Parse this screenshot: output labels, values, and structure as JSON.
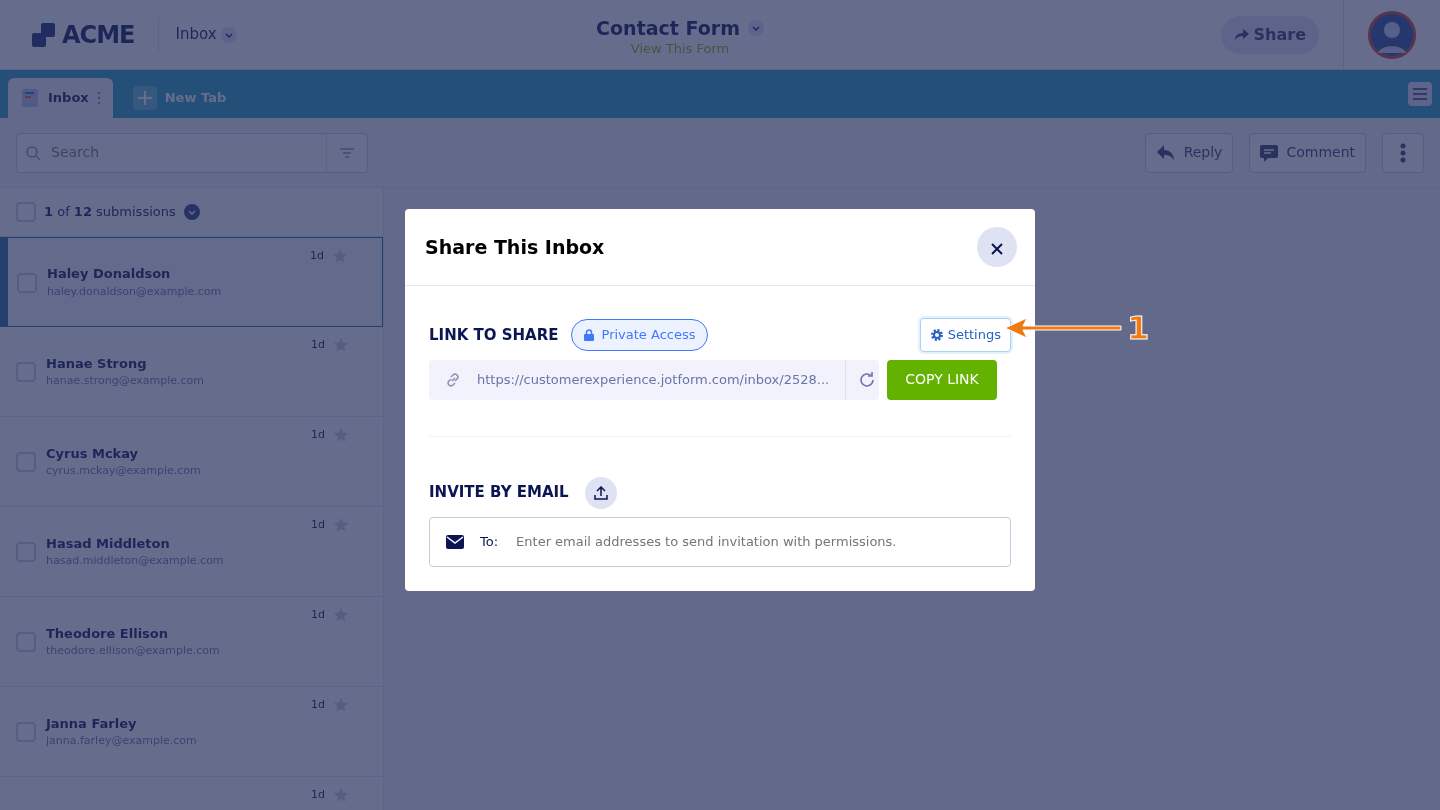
{
  "header": {
    "logo": "ACME",
    "section": "Inbox",
    "form_title": "Contact Form",
    "form_link": "View This Form",
    "share": "Share"
  },
  "tabs": [
    {
      "label": "Inbox",
      "selected": true
    },
    {
      "label": "New Tab",
      "selected": false
    }
  ],
  "search": {
    "placeholder": "Search"
  },
  "actions": [
    "Reply",
    "Comment"
  ],
  "select_all": {
    "checked": false
  },
  "list_summary": "**1** of **12** submissions",
  "submissions": [
    {
      "name": "Haley Donaldson",
      "email": "haley.donaldson@example.com",
      "time": "1d",
      "selected": true,
      "starred": false
    },
    {
      "name": "Hanae Strong",
      "email": "hanae.strong@example.com",
      "time": "1d",
      "selected": false,
      "starred": false
    },
    {
      "name": "Cyrus Mckay",
      "email": "cyrus.mckay@example.com",
      "time": "1d",
      "selected": false,
      "starred": false
    },
    {
      "name": "Hasad Middleton",
      "email": "hasad.middleton@example.com",
      "time": "1d",
      "selected": false,
      "starred": false
    },
    {
      "name": "Theodore Ellison",
      "email": "theodore.ellison@example.com",
      "time": "1d",
      "selected": false,
      "starred": false
    },
    {
      "name": "Janna Farley",
      "email": "janna.farley@example.com",
      "time": "1d",
      "selected": false,
      "starred": false
    },
    {
      "time": "1d",
      "selected": false,
      "starred": false
    }
  ],
  "modal": {
    "title": "Share This Inbox",
    "link_heading": "LINK TO SHARE",
    "access": "Private Access",
    "settings": "Settings",
    "url": "https://customerexperience.jotform.com/inbox/2528...",
    "copy": "COPY LINK",
    "invite_heading": "INVITE BY EMAIL",
    "to_label": "To:",
    "email_placeholder": "Enter email addresses to send invitation with permissions."
  },
  "annotation": {
    "label": "1"
  }
}
